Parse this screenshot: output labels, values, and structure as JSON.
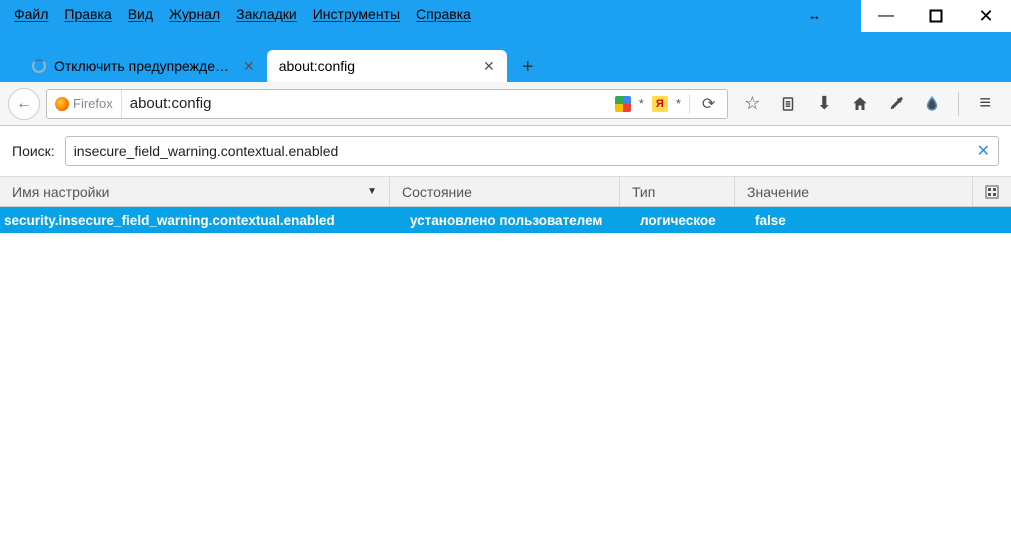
{
  "menu": {
    "file": "Файл",
    "edit": "Правка",
    "view": "Вид",
    "history": "Журнал",
    "bookmarks": "Закладки",
    "tools": "Инструменты",
    "help": "Справка"
  },
  "tabs": [
    {
      "title": "Отключить предупрежде…",
      "active": false
    },
    {
      "title": "about:config",
      "active": true
    }
  ],
  "urlbar": {
    "identity": "Firefox",
    "url": "about:config"
  },
  "search": {
    "label": "Поиск:",
    "value": "insecure_field_warning.contextual.enabled"
  },
  "columns": {
    "name": "Имя настройки",
    "state": "Состояние",
    "type": "Тип",
    "value": "Значение"
  },
  "row": {
    "name": "security.insecure_field_warning.contextual.enabled",
    "state": "установлено пользователем",
    "type": "логическое",
    "value": "false"
  },
  "glyphs": {
    "star_outline": "☆",
    "down_arrow": "⬇",
    "resize": "↔",
    "y_letter": "Я",
    "asterisk": "*",
    "sort_down": "▼",
    "plus": "+",
    "close_x": "✕",
    "back": "←",
    "reload": "⟳",
    "hamburger": "≡",
    "minus": "—"
  }
}
